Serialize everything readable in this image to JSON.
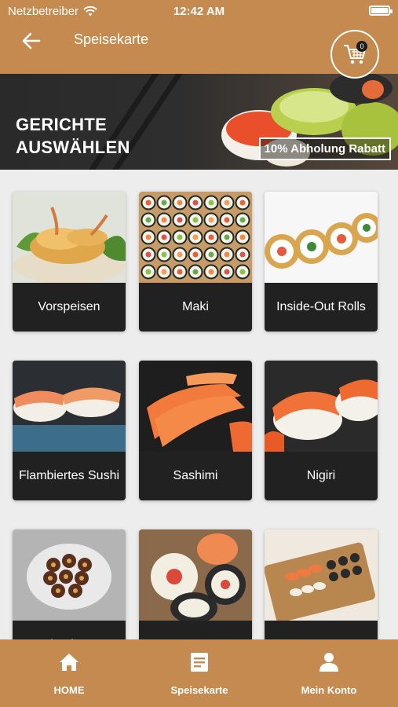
{
  "status_bar": {
    "carrier": "Netzbetreiber",
    "time": "12:42 AM"
  },
  "header": {
    "title": "Speisekarte",
    "cart_count": "0"
  },
  "banner": {
    "headline_line1": "GERICHTE",
    "headline_line2": "AUSWÄHLEN",
    "promo": "10% Abholung Rabatt"
  },
  "categories": [
    {
      "label": "Vorspeisen"
    },
    {
      "label": "Maki"
    },
    {
      "label": "Inside-Out Rolls"
    },
    {
      "label": "Flambiertes Sushi"
    },
    {
      "label": "Sashimi"
    },
    {
      "label": "Nigiri"
    },
    {
      "label": "Gebackenes"
    },
    {
      "label": ""
    },
    {
      "label": ""
    }
  ],
  "bottom_nav": {
    "home": "HOME",
    "menu": "Speisekarte",
    "account": "Mein Konto"
  },
  "colors": {
    "brand": "#c48a4f",
    "card_label_bg": "#212121",
    "page_bg": "#ededed"
  }
}
